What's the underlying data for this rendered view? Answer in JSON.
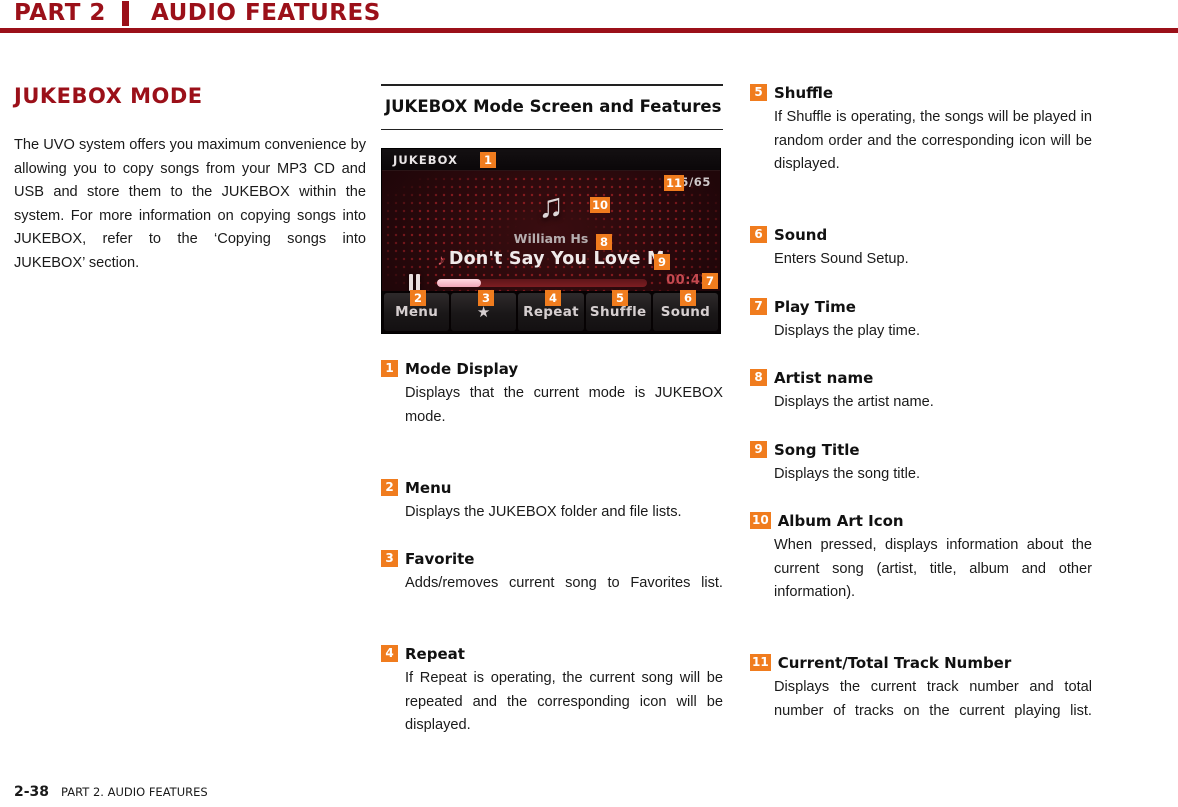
{
  "header": {
    "part_label": "PART 2",
    "section_title": "AUDIO FEATURES",
    "accent_color": "#9B1019"
  },
  "left_column": {
    "title": "JUKEBOX MODE",
    "paragraph": "The UVO system offers you maximum convenience by allowing you to copy songs from your MP3 CD and USB and store them to the JUKEBOX within the system. For more information on copying songs into JUKEBOX, refer to the ‘Copying songs into JUKEBOX’ section."
  },
  "middle_column": {
    "heading": "JUKEBOX Mode Screen and Features"
  },
  "device_screen": {
    "mode_label": "JUKEBOX",
    "track_counter": "5/65",
    "album_art_icon": "music-note-icon",
    "artist": "William Hs",
    "song_icon": "music-note-small-icon",
    "song_title": "Don't Say You Love M",
    "transport_state_icon": "pause-icon",
    "progress_percent": 21,
    "play_time": "00:42",
    "buttons": [
      {
        "id": "menu",
        "label": "Menu",
        "icon": ""
      },
      {
        "id": "favorite",
        "label": "★",
        "icon": "star-icon"
      },
      {
        "id": "repeat",
        "label": "Repeat",
        "icon": ""
      },
      {
        "id": "shuffle",
        "label": "Shuffle",
        "icon": ""
      },
      {
        "id": "sound",
        "label": "Sound",
        "icon": ""
      }
    ],
    "callouts": [
      "1",
      "2",
      "3",
      "4",
      "5",
      "6",
      "7",
      "8",
      "9",
      "10",
      "11"
    ]
  },
  "features_middle": [
    {
      "num": "1",
      "title": "Mode Display",
      "desc": "Displays that the current mode is JUKEBOX mode.",
      "spread": true
    },
    {
      "num": "2",
      "title": "Menu",
      "desc": "Displays the JUKEBOX folder and file lists.",
      "spread": false
    },
    {
      "num": "3",
      "title": "Favorite",
      "desc": "Adds/removes current song to Favorites list.",
      "spread": true
    },
    {
      "num": "4",
      "title": "Repeat",
      "desc": "If Repeat is operating, the current song will be repeated and the corresponding icon will be displayed.",
      "spread": true
    }
  ],
  "features_right": [
    {
      "num": "5",
      "title": "Shuffle",
      "desc": "If Shuffle is operating, the songs will be played in random order and the corresponding icon will be displayed.",
      "spread": true
    },
    {
      "num": "6",
      "title": "Sound",
      "desc": "Enters Sound Setup.",
      "spread": false
    },
    {
      "num": "7",
      "title": "Play Time",
      "desc": "Displays the play time.",
      "spread": false
    },
    {
      "num": "8",
      "title": "Artist name",
      "desc": "Displays the artist name.",
      "spread": false
    },
    {
      "num": "9",
      "title": "Song Title",
      "desc": "Displays the song title.",
      "spread": false
    },
    {
      "num": "10",
      "title": "Album Art Icon",
      "desc": "When pressed, displays information about the current song (artist, title, album and other information).",
      "spread": true
    },
    {
      "num": "11",
      "title": "Current/Total Track Number",
      "desc": "Displays the current track number and total number of tracks on the current playing list.",
      "spread": true
    }
  ],
  "footer": {
    "page_number": "2-38",
    "page_label": "PART 2. AUDIO FEATURES"
  }
}
